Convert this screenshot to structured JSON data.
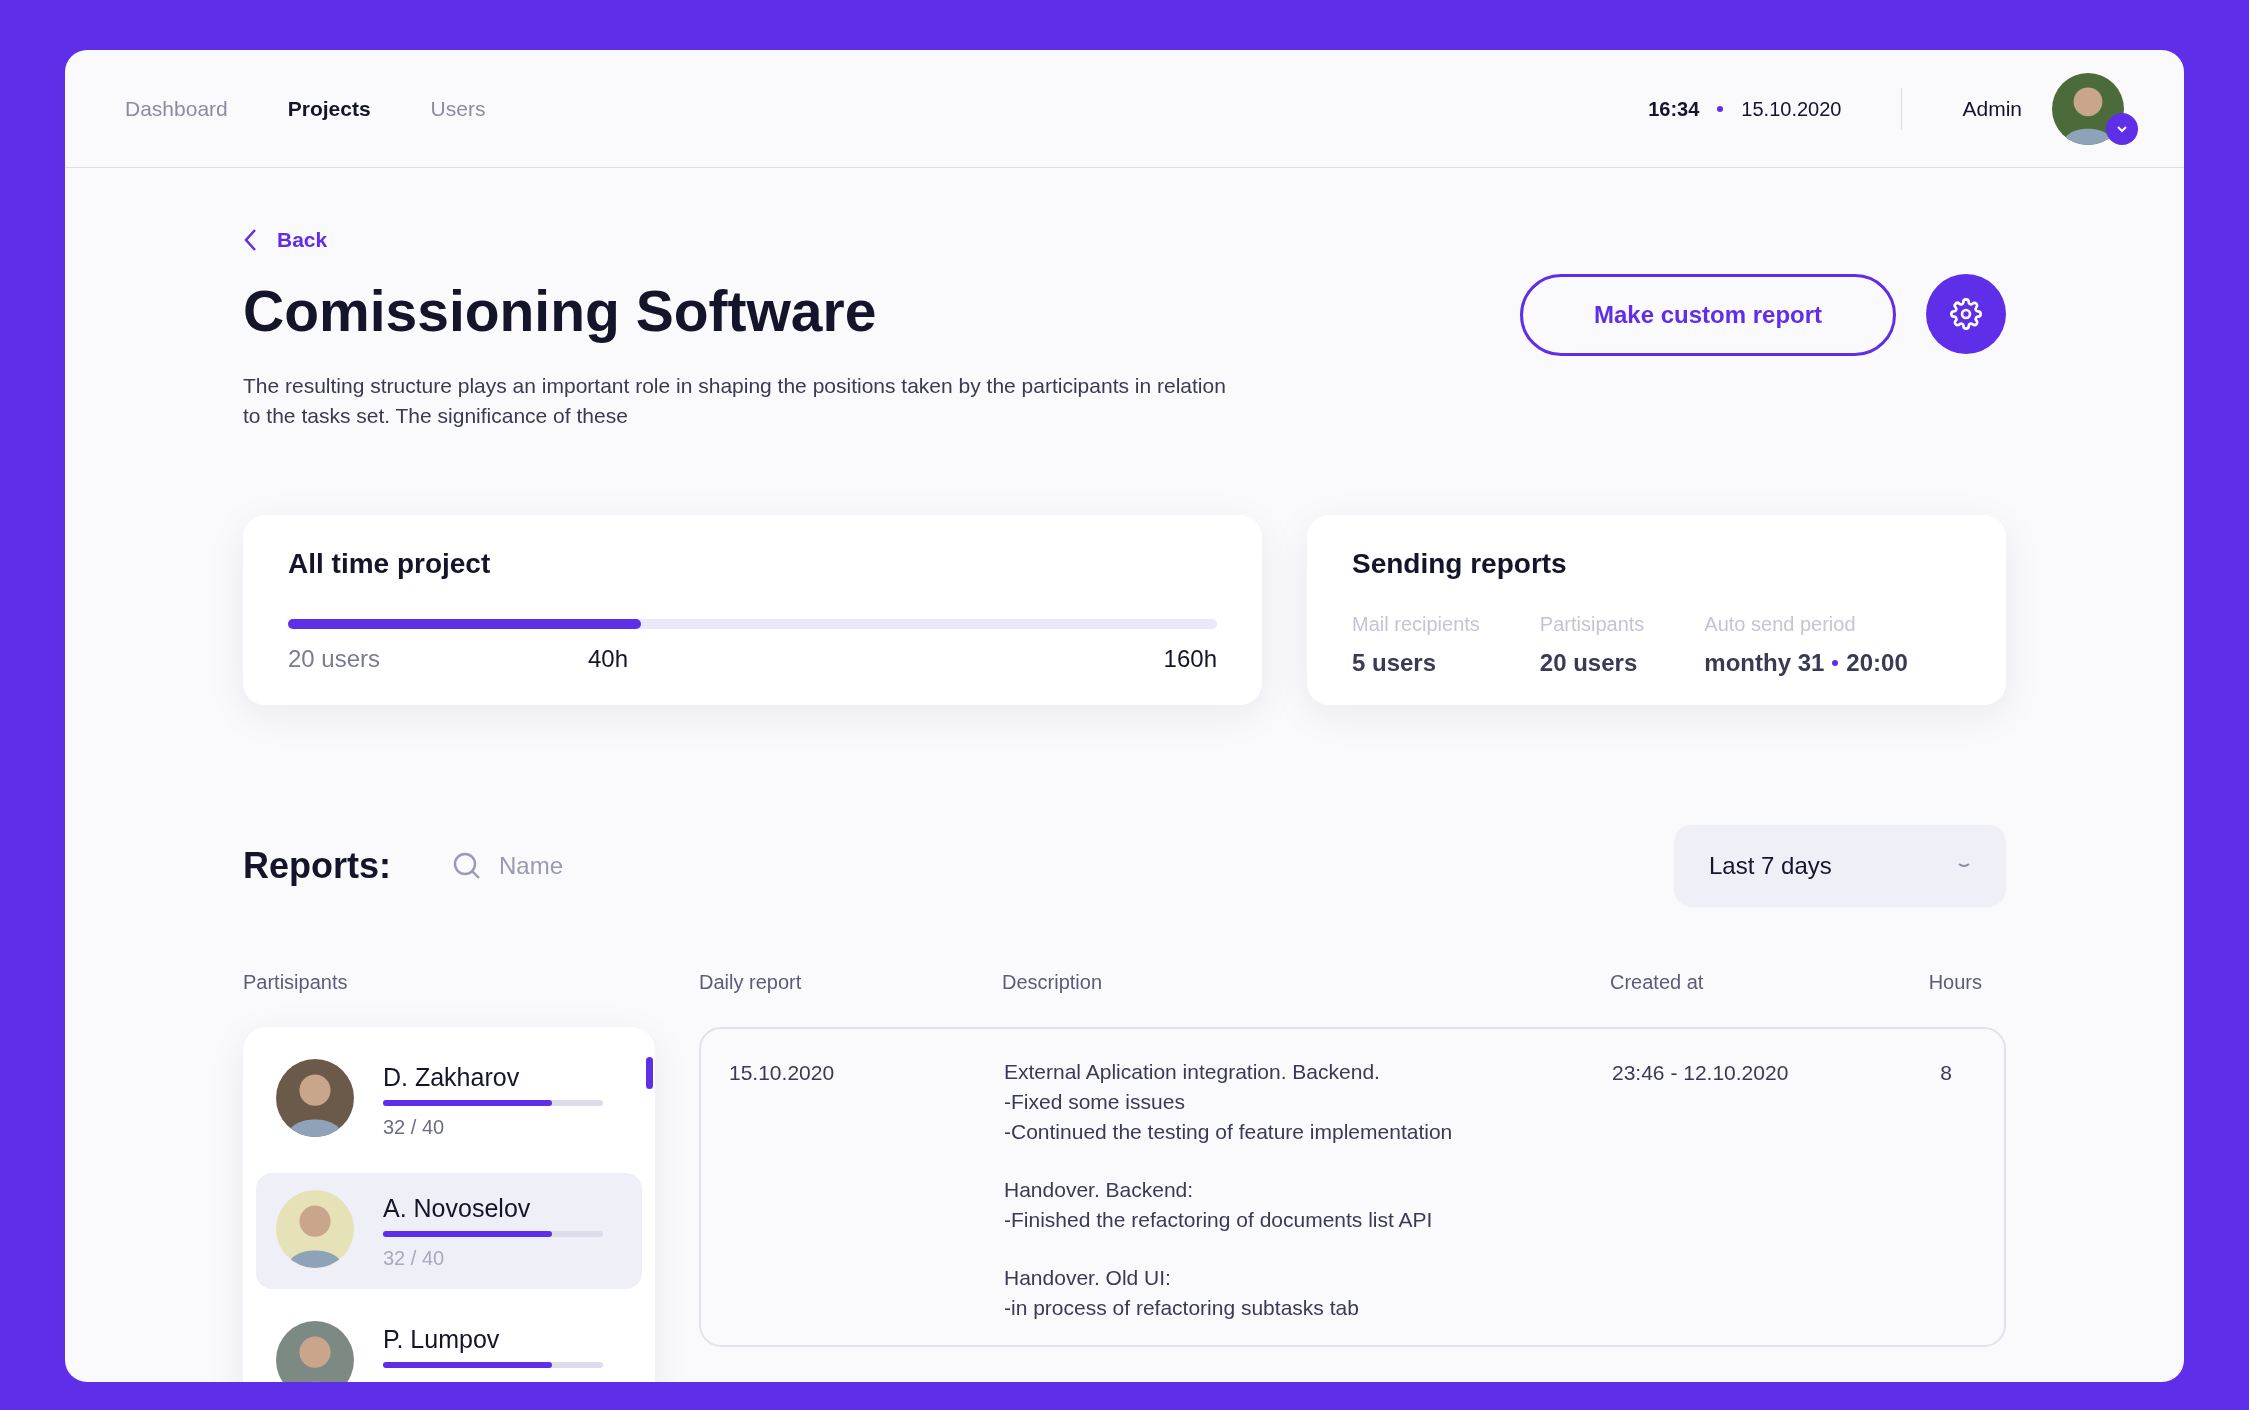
{
  "nav": [
    {
      "label": "Dashboard",
      "selected": false
    },
    {
      "label": "Projects",
      "selected": true
    },
    {
      "label": "Users",
      "selected": false
    }
  ],
  "header": {
    "time": "16:34",
    "date": "15.10.2020",
    "user": "Admin"
  },
  "back": "Back",
  "title": "Comissioning Software",
  "description": "The resulting structure plays an important role in shaping the positions taken by the participants in relation to the tasks set. The significance of these",
  "custom_report_button": "Make custom report",
  "all_time": {
    "title": "All time project",
    "level": 0.38,
    "users": "20 users",
    "spent": "40h",
    "total": "160h"
  },
  "sending": {
    "title": "Sending reports",
    "fields": [
      {
        "label": "Mail recipients",
        "value": "5 users"
      },
      {
        "label": "Partisipants",
        "value": "20 users"
      },
      {
        "label": "Auto send period",
        "value": "monthy 31",
        "extra": "20:00"
      }
    ]
  },
  "reports": {
    "title": "Reports:",
    "search_placeholder": "Name",
    "period": "Last 7 days"
  },
  "columns": [
    "Partisipants",
    "Daily report",
    "Description",
    "Created at",
    "Hours"
  ],
  "participants": [
    {
      "name": "D. Zakharov",
      "level": 0.77,
      "reading": "32 / 40",
      "selected": false
    },
    {
      "name": "A. Novoselov",
      "level": 0.77,
      "reading": "32 / 40",
      "selected": true
    },
    {
      "name": "P. Lumpov",
      "level": 0.77,
      "selected": false
    }
  ],
  "rows": [
    {
      "date": "15.10.2020",
      "description": [
        [
          "External Aplication integration. Backend.",
          "-Fixed some issues",
          "-Continued the testing of feature implementation"
        ],
        [
          "Handover. Backend:",
          "-Finished the refactoring of documents list API"
        ],
        [
          "Handover. Old UI:",
          "-in process of refactoring subtasks tab"
        ]
      ],
      "created": "23:46 - 12.10.2020",
      "hours": "8"
    }
  ]
}
